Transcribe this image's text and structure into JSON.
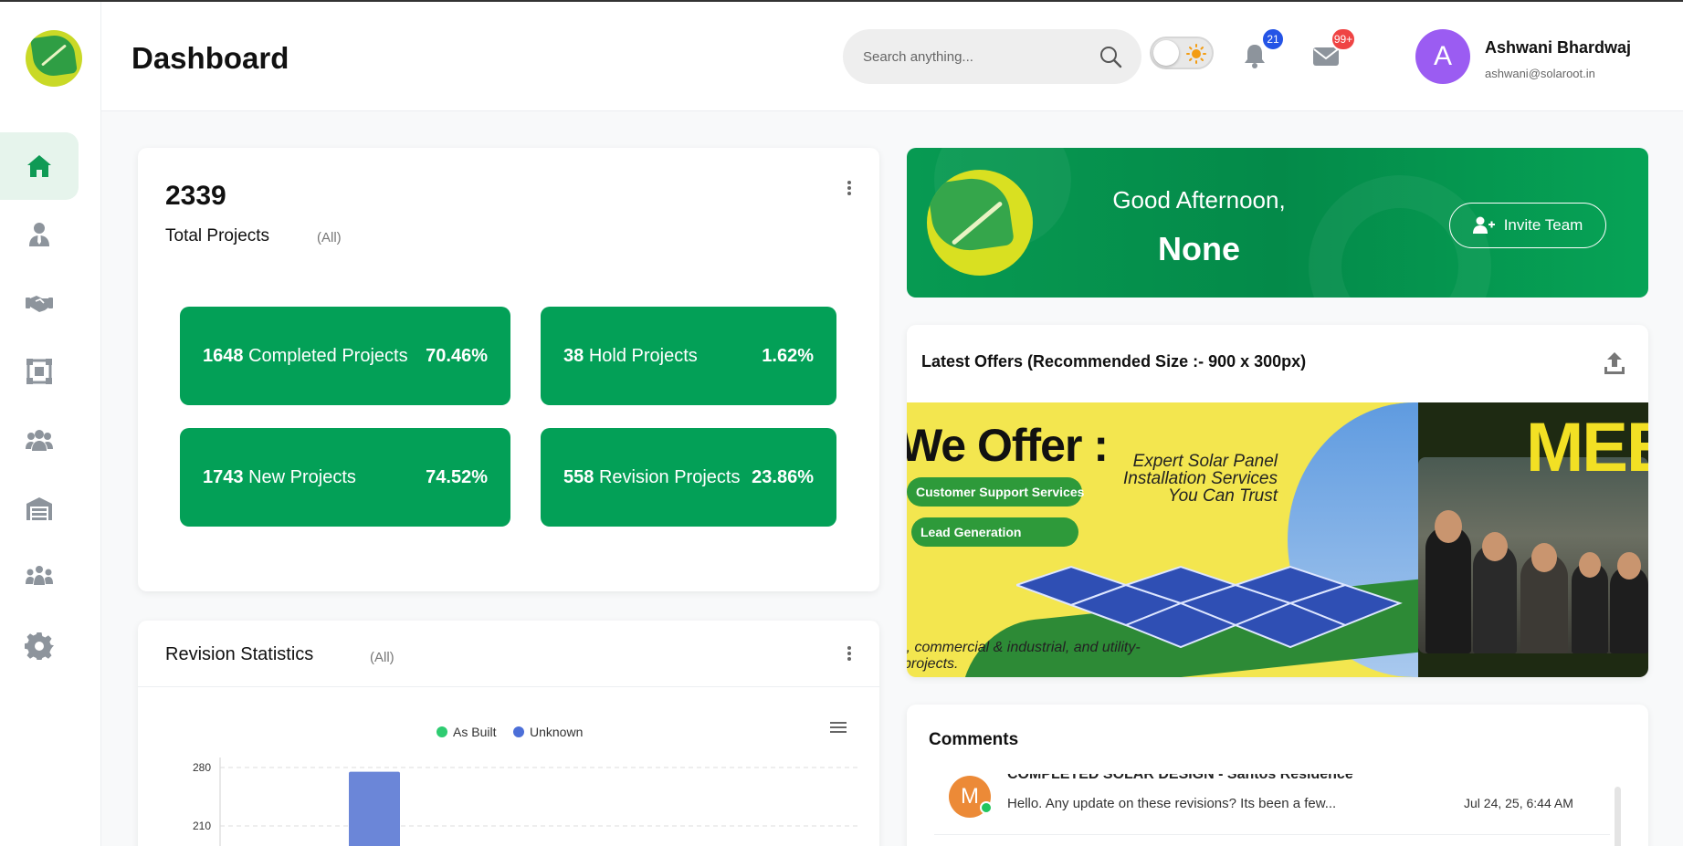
{
  "header": {
    "title": "Dashboard",
    "search_placeholder": "Search anything...",
    "notifications_count": "21",
    "messages_count": "99+",
    "user": {
      "initial": "A",
      "name": "Ashwani Bhardwaj",
      "email": "ashwani@solaroot.in"
    }
  },
  "sidebar": {
    "items": [
      {
        "icon": "home-icon",
        "active": true
      },
      {
        "icon": "user-tie-icon",
        "active": false
      },
      {
        "icon": "handshake-icon",
        "active": false
      },
      {
        "icon": "project-diagram-icon",
        "active": false
      },
      {
        "icon": "users-icon",
        "active": false
      },
      {
        "icon": "warehouse-icon",
        "active": false
      },
      {
        "icon": "team-icon",
        "active": false
      },
      {
        "icon": "gear-icon",
        "active": false
      }
    ]
  },
  "projects": {
    "total": "2339",
    "label": "Total Projects",
    "filter": "(All)",
    "stats": [
      {
        "value": "1648",
        "label": "Completed Projects",
        "percent": "70.46%"
      },
      {
        "value": "38",
        "label": "Hold Projects",
        "percent": "1.62%"
      },
      {
        "value": "1743",
        "label": "New Projects",
        "percent": "74.52%"
      },
      {
        "value": "558",
        "label": "Revision Projects",
        "percent": "23.86%"
      }
    ]
  },
  "revision": {
    "title": "Revision Statistics",
    "filter": "(All)",
    "legend": [
      {
        "name": "As Built",
        "color": "#2ecc71"
      },
      {
        "name": "Unknown",
        "color": "#4c6fd8"
      }
    ]
  },
  "chart_data": {
    "type": "bar",
    "title": "",
    "xlabel": "",
    "ylabel": "",
    "ytick_labels": [
      "280",
      "210"
    ],
    "series": [
      {
        "name": "As Built",
        "values": []
      },
      {
        "name": "Unknown",
        "values": [
          275
        ]
      }
    ],
    "legend": "top-center",
    "grid": true
  },
  "banner": {
    "greeting": "Good Afternoon,",
    "name": "None",
    "invite_label": "Invite Team"
  },
  "offers": {
    "title": "Latest Offers (Recommended Size :- 900 x 300px)",
    "slide1": {
      "heading": "We Offer :",
      "subheading": "Expert Solar Panel Installation Services You Can Trust",
      "pills": [
        "Customer Support Services",
        "Lead Generation"
      ],
      "footer_line1": "l, commercial & industrial, and utility-",
      "footer_line2": "projects."
    },
    "slide2": {
      "heading": "MEE"
    }
  },
  "comments": {
    "title": "Comments",
    "items": [
      {
        "initial": "M",
        "author": "COMPLETED SOLAR DESIGN - Santos Residence",
        "text": "Hello. Any update on these revisions? Its been a few...",
        "time": "Jul 24, 25, 6:44 AM"
      }
    ]
  }
}
